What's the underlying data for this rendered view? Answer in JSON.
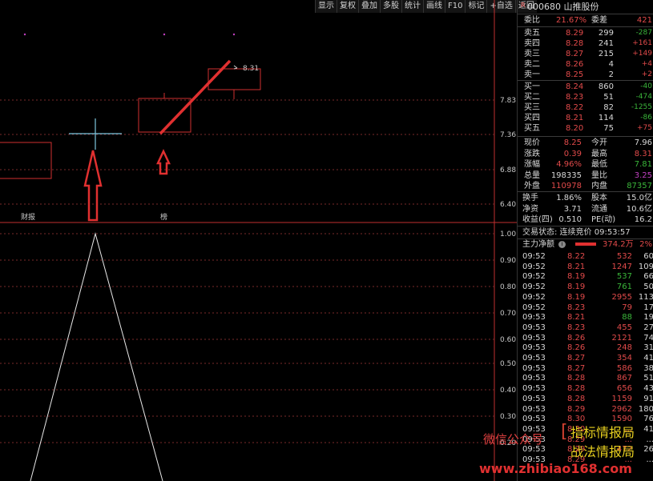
{
  "toolbar": [
    "显示",
    "复权",
    "叠加",
    "多股",
    "统计",
    "画线",
    "F10",
    "标记",
    "+自选",
    "返回"
  ],
  "chart": {
    "price_ticks": [
      "7.83",
      "7.36",
      "6.88",
      "6.40"
    ],
    "osc_ticks": [
      "1.00",
      "0.90",
      "0.80",
      "0.70",
      "0.60",
      "0.50",
      "0.40",
      "0.30",
      "0.20"
    ],
    "candle_label": "8.31",
    "events": [
      "财报",
      "榜"
    ]
  },
  "stock": {
    "badge": "R",
    "code_name": "000680 山推股份"
  },
  "ratio": {
    "wb_label": "委比",
    "wb_value": "21.67%",
    "wc_label": "委差",
    "wc_value": "421"
  },
  "sells": [
    {
      "label": "卖五",
      "price": "8.29",
      "vol": "299",
      "chg": "-287"
    },
    {
      "label": "卖四",
      "price": "8.28",
      "vol": "241",
      "chg": "+161"
    },
    {
      "label": "卖三",
      "price": "8.27",
      "vol": "215",
      "chg": "+149"
    },
    {
      "label": "卖二",
      "price": "8.26",
      "vol": "4",
      "chg": "+4"
    },
    {
      "label": "卖一",
      "price": "8.25",
      "vol": "2",
      "chg": "+2"
    }
  ],
  "buys": [
    {
      "label": "买一",
      "price": "8.24",
      "vol": "860",
      "chg": "-40"
    },
    {
      "label": "买二",
      "price": "8.23",
      "vol": "51",
      "chg": "-474"
    },
    {
      "label": "买三",
      "price": "8.22",
      "vol": "82",
      "chg": "-1255"
    },
    {
      "label": "买四",
      "price": "8.21",
      "vol": "114",
      "chg": "-86"
    },
    {
      "label": "买五",
      "price": "8.20",
      "vol": "75",
      "chg": "+75"
    }
  ],
  "quote": [
    {
      "l1": "现价",
      "v1": "8.25",
      "l2": "今开",
      "v2": "7.96"
    },
    {
      "l1": "涨跌",
      "v1": "0.39",
      "l2": "最高",
      "v2": "8.31"
    },
    {
      "l1": "涨幅",
      "v1": "4.96%",
      "l2": "最低",
      "v2": "7.81"
    },
    {
      "l1": "总量",
      "v1": "198335",
      "l2": "量比",
      "v2": "3.25"
    },
    {
      "l1": "外盘",
      "v1": "110978",
      "l2": "内盘",
      "v2": "87357"
    }
  ],
  "stats": [
    {
      "l1": "换手",
      "v1": "1.86%",
      "l2": "股本",
      "v2": "15.0亿"
    },
    {
      "l1": "净资",
      "v1": "3.71",
      "l2": "流通",
      "v2": "10.6亿"
    },
    {
      "l1": "收益(四)",
      "v1": "0.510",
      "l2": "PE(动)",
      "v2": "16.2"
    }
  ],
  "trade_status": "交易状态: 连续竞价 09:53:57",
  "main_flow": {
    "label": "主力净额",
    "value": "374.2万",
    "pct": "2%"
  },
  "ticks": [
    {
      "t": "09:52",
      "p": "8.22",
      "v": "532",
      "n": "60"
    },
    {
      "t": "09:52",
      "p": "8.21",
      "v": "1247",
      "n": "109"
    },
    {
      "t": "09:52",
      "p": "8.19",
      "v": "537",
      "n": "66"
    },
    {
      "t": "09:52",
      "p": "8.19",
      "v": "761",
      "n": "50"
    },
    {
      "t": "09:52",
      "p": "8.19",
      "v": "2955",
      "n": "113"
    },
    {
      "t": "09:52",
      "p": "8.23",
      "v": "79",
      "n": "17"
    },
    {
      "t": "09:53",
      "p": "8.21",
      "v": "88",
      "n": "19"
    },
    {
      "t": "09:53",
      "p": "8.23",
      "v": "455",
      "n": "27"
    },
    {
      "t": "09:53",
      "p": "8.26",
      "v": "2121",
      "n": "74"
    },
    {
      "t": "09:53",
      "p": "8.26",
      "v": "248",
      "n": "31"
    },
    {
      "t": "09:53",
      "p": "8.27",
      "v": "354",
      "n": "41"
    },
    {
      "t": "09:53",
      "p": "8.27",
      "v": "586",
      "n": "38"
    },
    {
      "t": "09:53",
      "p": "8.28",
      "v": "867",
      "n": "51"
    },
    {
      "t": "09:53",
      "p": "8.28",
      "v": "656",
      "n": "43"
    },
    {
      "t": "09:53",
      "p": "8.28",
      "v": "1159",
      "n": "91"
    },
    {
      "t": "09:53",
      "p": "8.29",
      "v": "2962",
      "n": "180"
    },
    {
      "t": "09:53",
      "p": "8.30",
      "v": "1590",
      "n": "76"
    },
    {
      "t": "09:53",
      "p": "8.30",
      "v": "...",
      "n": "41"
    },
    {
      "t": "09:53",
      "p": "8.29",
      "v": "...",
      "n": "..."
    },
    {
      "t": "09:53",
      "p": "8.29",
      "v": "472",
      "n": "26"
    },
    {
      "t": "09:53",
      "p": "8.29",
      "v": "...",
      "n": "..."
    }
  ],
  "watermark": {
    "left": "微信公众号",
    "line1": "指标情报局",
    "line2": "战法情报局",
    "url": "www.zhibiao168.com"
  }
}
